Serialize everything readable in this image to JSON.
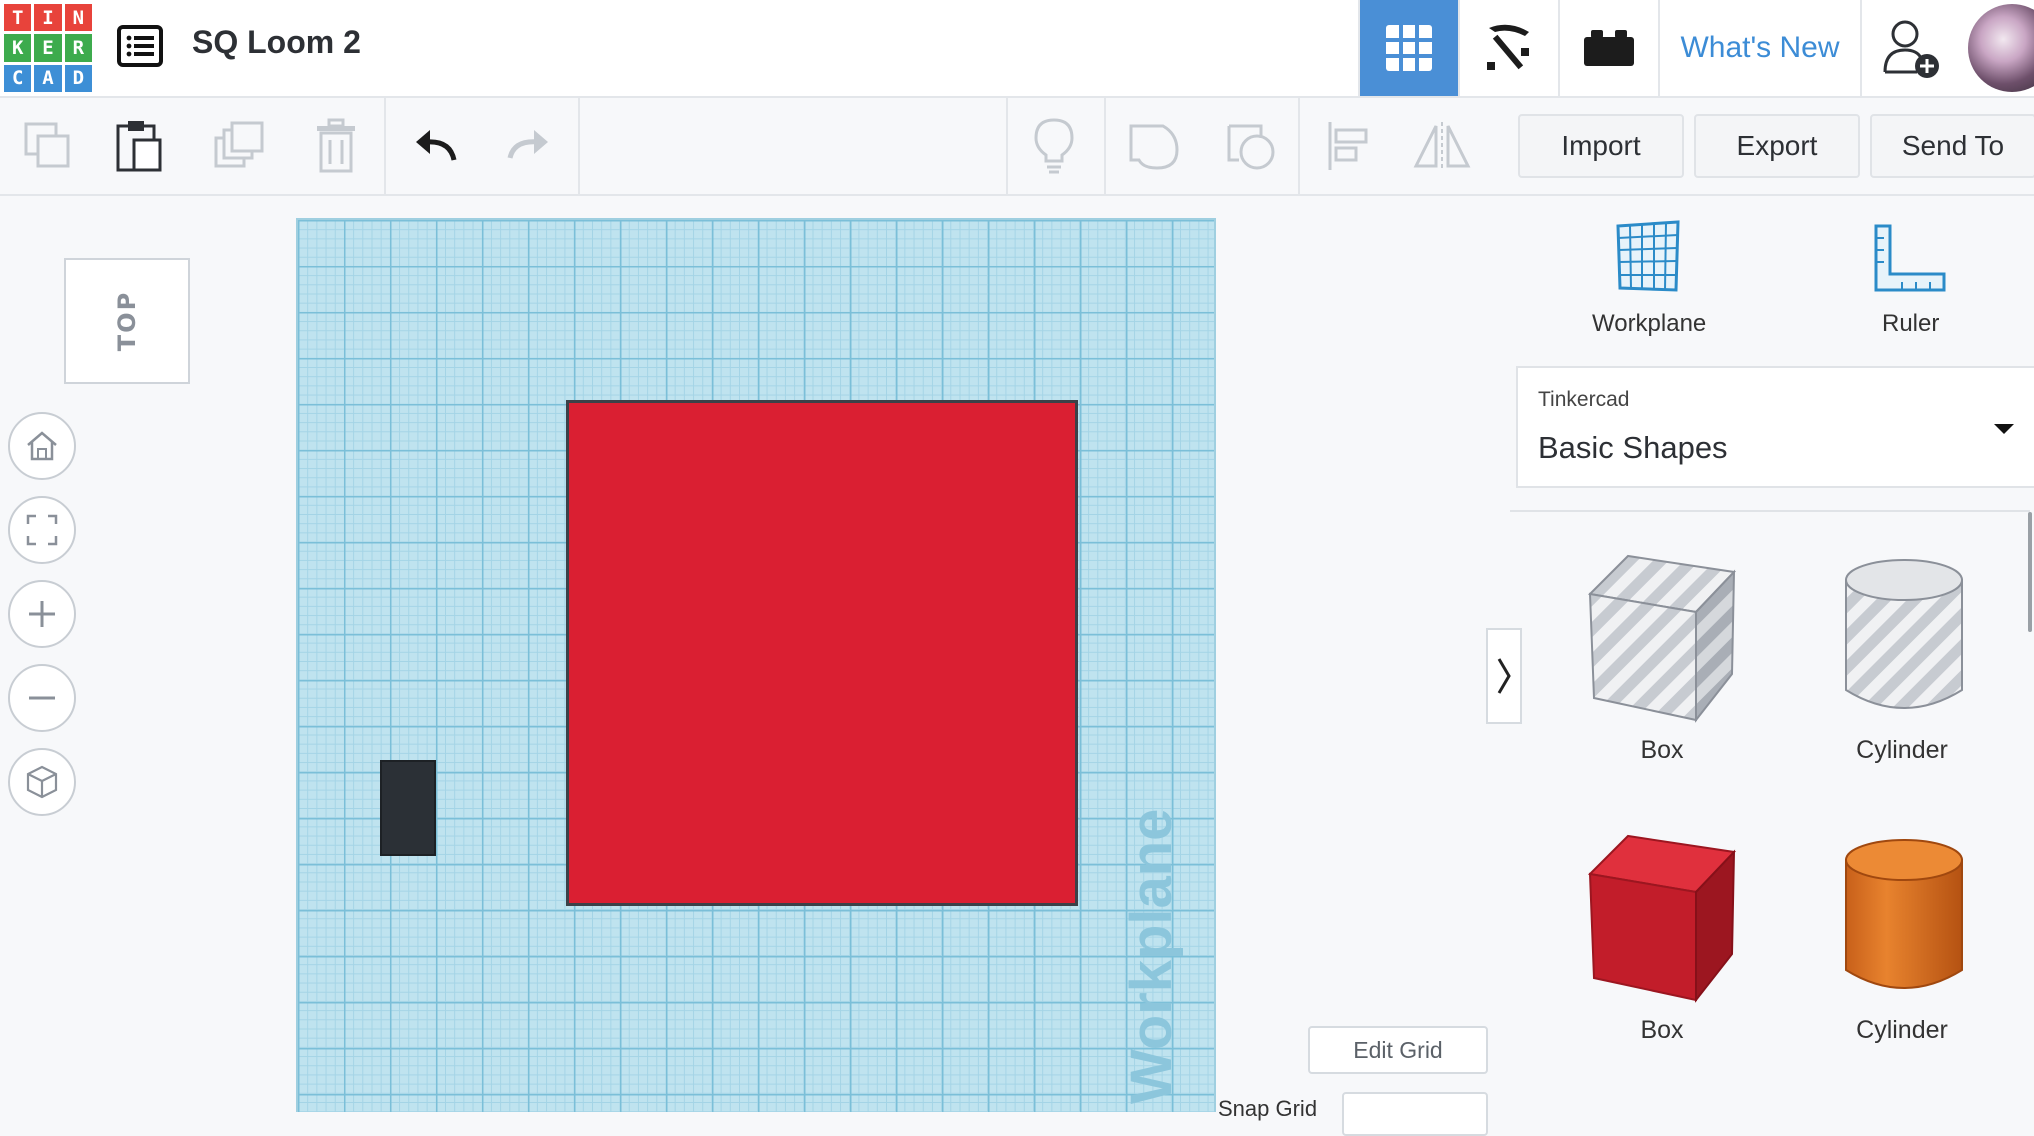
{
  "header": {
    "logo_letters": [
      "T",
      "I",
      "N",
      "K",
      "E",
      "R",
      "C",
      "A",
      "D"
    ],
    "logo_colors": [
      "#e8433b",
      "#e8433b",
      "#e8433b",
      "#3dab4d",
      "#3dab4d",
      "#3dab4d",
      "#3d8fd6",
      "#3d8fd6",
      "#3d8fd6"
    ],
    "design_title": "SQ Loom 2",
    "whats_new": "What's New",
    "accent_color": "#4a8fd6",
    "icons": [
      "design-list-icon",
      "3d-design-grid-icon",
      "codeblocks-pickaxe-icon",
      "lego-brick-icon",
      "add-user-icon"
    ]
  },
  "toolbar": {
    "tools": [
      "copy-icon",
      "paste-icon",
      "duplicate-icon",
      "delete-icon",
      "undo-icon",
      "redo-icon",
      "light-bulb-icon",
      "shape-solid-icon",
      "shape-hole-icon",
      "align-icon",
      "mirror-icon"
    ],
    "import_label": "Import",
    "export_label": "Export",
    "send_to_label": "Send To"
  },
  "view": {
    "viewcube_face": "TOP",
    "nav_buttons": [
      "home-view-icon",
      "fit-view-icon",
      "zoom-in-icon",
      "zoom-out-icon",
      "orthographic-view-icon"
    ]
  },
  "workplane": {
    "watermark": "Workplane",
    "edit_grid_label": "Edit Grid",
    "snap_grid_label": "Snap Grid",
    "objects": [
      {
        "name": "red box",
        "color": "#da1f32"
      },
      {
        "name": "dark box",
        "color": "#2b3036"
      }
    ]
  },
  "panel": {
    "workplane_label": "Workplane",
    "ruler_label": "Ruler",
    "library_source": "Tinkercad",
    "library_name": "Basic Shapes",
    "shapes": [
      {
        "label": "Box",
        "style": "hole"
      },
      {
        "label": "Cylinder",
        "style": "hole"
      },
      {
        "label": "Box",
        "style": "solid",
        "color": "#c8202e"
      },
      {
        "label": "Cylinder",
        "style": "solid",
        "color": "#e07a22"
      }
    ]
  }
}
